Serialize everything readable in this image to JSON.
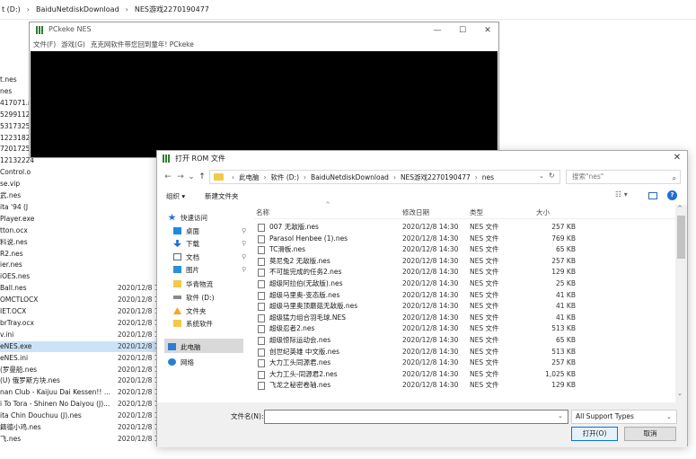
{
  "bg_breadcrumb": [
    "t (D:)",
    "BaiduNetdiskDownload",
    "NES游戏2270190477"
  ],
  "bg_files": [
    {
      "name": "t.nes",
      "date": ""
    },
    {
      "name": "nes",
      "date": ""
    },
    {
      "name": "417071.nes",
      "date": ""
    },
    {
      "name": "52991120",
      "date": ""
    },
    {
      "name": "53173259",
      "date": ""
    },
    {
      "name": "12231821",
      "date": ""
    },
    {
      "name": "72017254",
      "date": ""
    },
    {
      "name": "12132224",
      "date": ""
    },
    {
      "name": "Control.o",
      "date": ""
    },
    {
      "name": "se.vip",
      "date": ""
    },
    {
      "name": "武.nes",
      "date": ""
    },
    {
      "name": "ita '94 (J",
      "date": ""
    },
    {
      "name": "Player.exe",
      "date": ""
    },
    {
      "name": "tton.ocx",
      "date": ""
    },
    {
      "name": "料说.nes",
      "date": ""
    },
    {
      "name": "R2.nes",
      "date": ""
    },
    {
      "name": "ier.nes",
      "date": ""
    },
    {
      "name": "iOES.nes",
      "date": ""
    },
    {
      "name": "Ball.nes",
      "date": "2020/12/8 1"
    },
    {
      "name": "OMCTLOCX",
      "date": "2020/12/8 1"
    },
    {
      "name": "IET.OCX",
      "date": "2020/12/8 1"
    },
    {
      "name": "brTray.ocx",
      "date": "2020/12/8 1"
    },
    {
      "name": "v.ini",
      "date": "2020/12/8 1"
    },
    {
      "name": "eNES.exe",
      "date": "2020/12/8 1"
    },
    {
      "name": "eNES.ini",
      "date": "2020/12/8 1"
    },
    {
      "name": "(罗曼船.nes",
      "date": "2020/12/8 1"
    },
    {
      "name": "(U) 俄罗斯方块.nes",
      "date": "2020/12/8 1"
    },
    {
      "name": "nan Club - Kaijuu Dai Kessen!! ...",
      "date": "2020/12/8 1"
    },
    {
      "name": "i To Tora - Shinen No Daiyou (J)...",
      "date": "2020/12/8 1"
    },
    {
      "name": "ita Chin Douchuu (J).nes",
      "date": "2020/12/8 1"
    },
    {
      "name": "籍德小鸡.nes",
      "date": "2020/12/8 1"
    },
    {
      "name": "飞.nes",
      "date": "2020/12/8 1"
    }
  ],
  "pc_window": {
    "title": "PCkeke  NES",
    "menu": [
      "文件(F)",
      "游戏(G)",
      "克克网软件带您回到童年! PCkeke"
    ],
    "minimize": "—",
    "maximize": "☐",
    "close": "✕"
  },
  "dialog": {
    "title": "打开 ROM 文件",
    "close": "✕",
    "nav": {
      "back": "←",
      "forward": "→",
      "recent": "⌄",
      "up": "↑",
      "dropdown": "⌄",
      "refresh": "↻"
    },
    "address": [
      "此电脑",
      "软件 (D:)",
      "BaiduNetdiskDownload",
      "NES游戏2270190477",
      "nes"
    ],
    "search_placeholder": "搜索\"nes\"",
    "search_icon": "⌕",
    "toolbar": {
      "organize": "组织 ▾",
      "new_folder": "新建文件夹",
      "view": "☷ ▾",
      "help": "?"
    },
    "sidebar": [
      {
        "label": "快速访问",
        "icon": "star-icon",
        "pinned": false
      },
      {
        "label": "桌面",
        "icon": "desktop-icon",
        "pinned": true
      },
      {
        "label": "下载",
        "icon": "download-icon",
        "pinned": true
      },
      {
        "label": "文档",
        "icon": "document-icon",
        "pinned": true
      },
      {
        "label": "图片",
        "icon": "picture-icon",
        "pinned": true
      },
      {
        "label": "华青物流",
        "icon": "folder-icon",
        "pinned": false
      },
      {
        "label": "软件 (D:)",
        "icon": "drive-icon",
        "pinned": false
      },
      {
        "label": "文件夹",
        "icon": "warning-icon",
        "pinned": false
      },
      {
        "label": "系统软件",
        "icon": "folder-icon",
        "pinned": false
      },
      {
        "label": "此电脑",
        "icon": "computer-icon",
        "pinned": false
      },
      {
        "label": "网络",
        "icon": "network-icon",
        "pinned": false
      }
    ],
    "pin_glyph": "⚲",
    "columns": {
      "name": "名称",
      "date": "修改日期",
      "type": "类型",
      "size": "大小",
      "sort": "^"
    },
    "files": [
      {
        "name": "007 无敌版.nes",
        "date": "2020/12/8 14:30",
        "type": "NES 文件",
        "size": "257 KB"
      },
      {
        "name": "Parasol Henbee (1).nes",
        "date": "2020/12/8 14:30",
        "type": "NES 文件",
        "size": "769 KB"
      },
      {
        "name": "TC滑板.nes",
        "date": "2020/12/8 14:30",
        "type": "NES 文件",
        "size": "65 KB"
      },
      {
        "name": "莫尼兔2 无敌版.nes",
        "date": "2020/12/8 14:30",
        "type": "NES 文件",
        "size": "257 KB"
      },
      {
        "name": "不可能完成的任务2.nes",
        "date": "2020/12/8 14:30",
        "type": "NES 文件",
        "size": "129 KB"
      },
      {
        "name": "超级阿拉伯(无敌版).nes",
        "date": "2020/12/8 14:30",
        "type": "NES 文件",
        "size": "25 KB"
      },
      {
        "name": "超级马里奥-变态版.nes",
        "date": "2020/12/8 14:30",
        "type": "NES 文件",
        "size": "41 KB"
      },
      {
        "name": "超级马里奥顶蘑菇无敌版.nes",
        "date": "2020/12/8 14:30",
        "type": "NES 文件",
        "size": "41 KB"
      },
      {
        "name": "超级猛力组合羽毛球.NES",
        "date": "2020/12/8 14:30",
        "type": "NES 文件",
        "size": "41 KB"
      },
      {
        "name": "超级忍者2.nes",
        "date": "2020/12/8 14:30",
        "type": "NES 文件",
        "size": "513 KB"
      },
      {
        "name": "超级惊际运动会.nes",
        "date": "2020/12/8 14:30",
        "type": "NES 文件",
        "size": "65 KB"
      },
      {
        "name": "创世纪英雄 中文版.nes",
        "date": "2020/12/8 14:30",
        "type": "NES 文件",
        "size": "513 KB"
      },
      {
        "name": "大力工头同源君.nes",
        "date": "2020/12/8 14:30",
        "type": "NES 文件",
        "size": "257 KB"
      },
      {
        "name": "大力工头-同源君2.nes",
        "date": "2020/12/8 14:30",
        "type": "NES 文件",
        "size": "1,025 KB"
      },
      {
        "name": "飞龙之秘密卷轴.nes",
        "date": "2020/12/8 14:30",
        "type": "NES 文件",
        "size": "129 KB"
      }
    ],
    "scroll": {
      "up": "^",
      "down": "⌄"
    },
    "filename_label": "文件名(N):",
    "filename_value": "",
    "filetype": "All Support Types",
    "open_button": "打开(O)",
    "cancel_button": "取消"
  }
}
